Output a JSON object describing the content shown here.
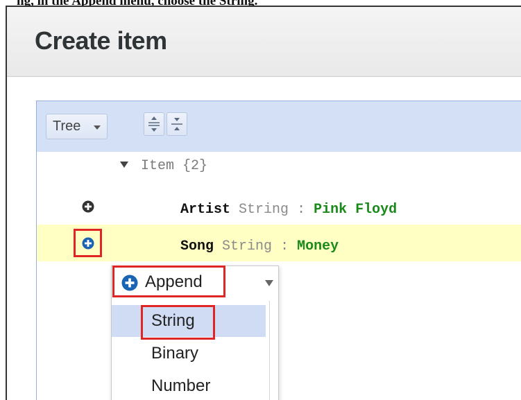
{
  "header_fragment": "ng,  in the Append menu, choose the String.",
  "dialog": {
    "title": "Create item"
  },
  "toolbar": {
    "mode_label": "Tree",
    "expand_all_icon": "expand-all-icon",
    "collapse_all_icon": "collapse-all-icon"
  },
  "tree": {
    "root": {
      "label": "Item {2}"
    },
    "fields": [
      {
        "key": "Artist",
        "type": "String",
        "separator": ":",
        "value": "Pink Floyd"
      },
      {
        "key": "Song",
        "type": "String",
        "separator": ":",
        "value": "Money"
      }
    ]
  },
  "context_menu": {
    "title": "Append",
    "items": [
      "String",
      "Binary",
      "Number"
    ],
    "selected": "String"
  },
  "colors": {
    "toolbar_bg": "#d4e0f5",
    "highlight_row": "#ffffc4",
    "value_green": "#1a8a1a",
    "accent_blue": "#1a64b4",
    "annotation_red": "#e02525"
  }
}
